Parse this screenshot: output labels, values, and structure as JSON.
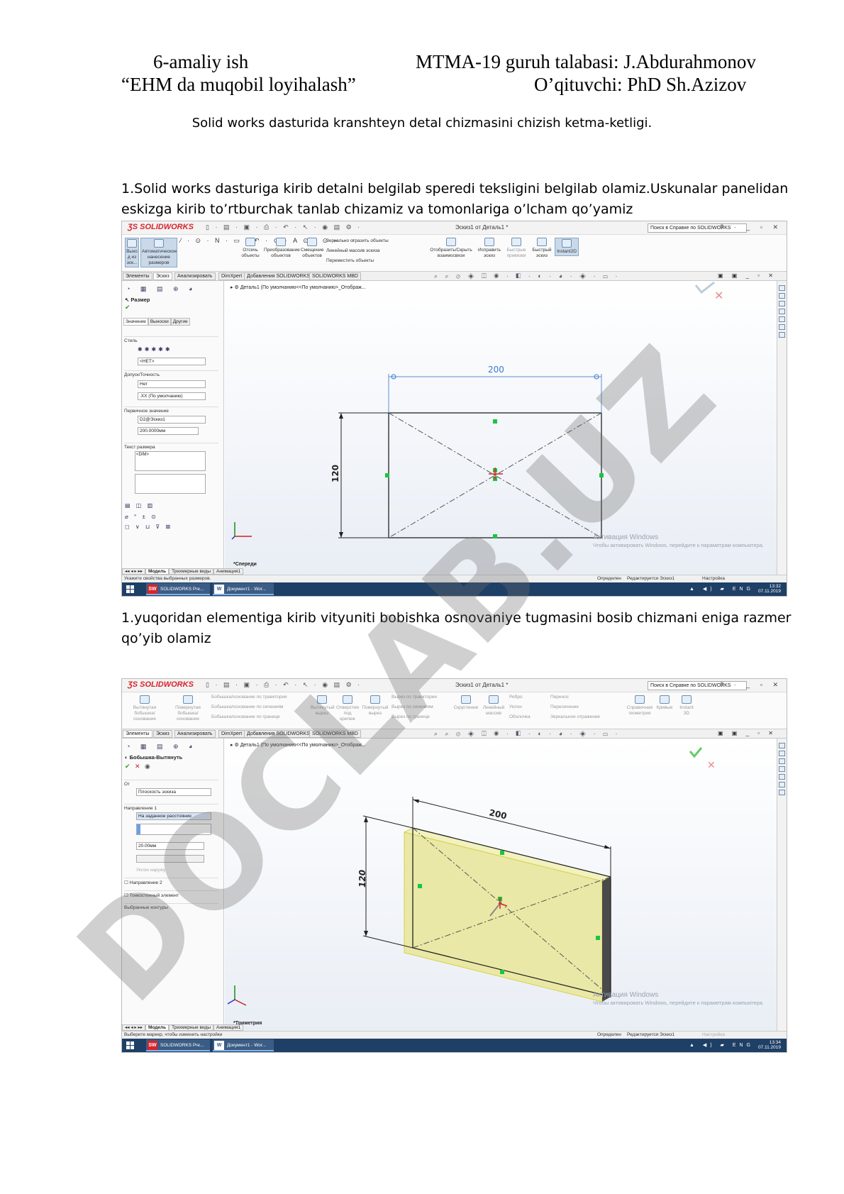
{
  "header": {
    "left_line1": "6-amaliy ish",
    "left_line2": "“EHM da muqobil loyihalash”",
    "right_line1": "MTMA-19 guruh talabasi:  J.Abdurahmonov",
    "right_line2": "O’qituvchi: PhD Sh.Azizov"
  },
  "subtitle": "Solid works dasturida kranshteyn detal chizmasini chizish ketma-ketligi.",
  "step1": {
    "line1": "1.Solid works dasturiga kirib detalni belgilab speredi teksligini belgilab olamiz.Uskunalar panelidan",
    "line2": "eskizga kirib to’rtburchak tanlab chizamiz va tomonlariga o’lcham qo’yamiz"
  },
  "step2": {
    "line1": "1.yuqoridan elementiga kirib vityuniti bobishka osnovaniye tugmasini bosib chizmani eniga razmer",
    "line2": "qo’yib olamiz"
  },
  "watermark": "DOCLAB.UZ",
  "screenshot1": {
    "app_logo": "SOLIDWORKS",
    "doc_title": "Эскиз1 от Деталь1 *",
    "help_search": "Поиск в Справке по SOLIDWORKS",
    "ribbon": {
      "exit_sketch": "Выхо д из эск...",
      "smart_dim": "Автоматическое нанесение размеров",
      "trim": "Отсечь объекты",
      "convert": "Преобразование объектов",
      "offset": "Смещение объектов",
      "mirror": "Зеркально отразить объекты",
      "linear_pattern": "Линейный массив эскиза",
      "move": "Переместить объекты",
      "show_hide": "Отобразить/Скрыть взаимосвязи",
      "repair": "Исправить эскиз",
      "quick_snaps": "Быстрые привязки",
      "rapid_sketch": "Быстрый эскиз",
      "instant2d": "Instant2D"
    },
    "tabs": [
      "Элементы",
      "Эскиз",
      "Анализировать",
      "DimXpert",
      "Добавления SOLIDWORKS",
      "SOLIDWORKS MBD"
    ],
    "panel": {
      "title": "Размер",
      "subtabs": [
        "Значение",
        "Выноски",
        "Другие"
      ],
      "style": "Стиль",
      "style_value": "<НЕТ>",
      "tolerance": "Допуск/Точность",
      "tol_value": "Нет",
      "precision_value": ".XX (По умолчанию)",
      "primary": "Первичное значение",
      "primary_name": "D2@Эскиз1",
      "primary_value": "200.0000мм",
      "dim_text": "Текст размера",
      "dim_text_value": "<DIM>"
    },
    "tree_item": "Деталь1  (По умолчанию<<По умолчанию>_Отображ...",
    "viewport": "*Спереди",
    "dim_width": "200",
    "dim_height": "120",
    "model_tabs": [
      "Модель",
      "Трехмерные виды",
      "Анимация1"
    ],
    "status_left": "Укажите свойства выбранных размеров.",
    "status_defined": "Определен",
    "status_editing": "Редактируется Эскиз1",
    "status_settings": "Настройка",
    "task_sw": "SOLIDWORKS Pre...",
    "task_word": "Документ1 - Wor...",
    "lang": "ENG",
    "time": "13:32",
    "date": "07.11.2019",
    "activation_title": "Активация Windows",
    "activation_text": "Чтобы активировать Windows, перейдите к параметрам компьютера."
  },
  "screenshot2": {
    "app_logo": "SOLIDWORKS",
    "doc_title": "Эскиз1 от Деталь1 *",
    "help_search": "Поиск в Справке по SOLIDWORKS",
    "ribbon": {
      "extrude_boss": "Вытянутая бобышка/основание",
      "revolve_boss": "Повернутая бобышка/основание",
      "swept_boss": "Бобышка/основание по траектории",
      "lofted_boss": "Бобышка/основание по сечениям",
      "boundary_boss": "Бобышка/основание по границе",
      "extruded_cut": "Вытянутый вырез",
      "hole": "Отверстие под крепеж",
      "revolved_cut": "Повернутый вырез",
      "swept_cut": "Вырез по траектории",
      "lofted_cut": "Вырез по сечениям",
      "boundary_cut": "Вырез по границе",
      "fillet": "Скругление",
      "linear_pattern": "Линейный массив",
      "rib": "Ребро",
      "draft": "Уклон",
      "shell": "Оболочка",
      "wrap": "Перенос",
      "intersect": "Пересечение",
      "mirror": "Зеркальное отражение",
      "ref_geometry": "Справочная геометрия",
      "curves": "Кривые",
      "instant3d": "Instant 3D"
    },
    "tabs": [
      "Элементы",
      "Эскиз",
      "Анализировать",
      "DimXpert",
      "Добавления SOLIDWORKS",
      "SOLIDWORKS MBD"
    ],
    "panel": {
      "title": "Бобышка-Вытянуть",
      "from": "От",
      "from_value": "Плоскость эскиза",
      "direction1": "Направление 1",
      "dir_value": "На заданное расстояние",
      "depth": "20.00мм",
      "draft": "Уклон наружу",
      "direction2": "Направление 2",
      "thin": "Тонкостенный элемент",
      "contours": "Выбранные контуры"
    },
    "tree_item": "Деталь1  (По умолчанию<<По умолчанию>_Отображ...",
    "viewport": "*Триметрия",
    "dim_width": "200",
    "dim_height": "120",
    "model_tabs": [
      "Модель",
      "Трехмерные виды",
      "Анимация1"
    ],
    "status_left": "Выберите маркер, чтобы изменить настройки",
    "status_defined": "Определен",
    "status_editing": "Редактируется Эскиз1",
    "status_settings": "Настройка",
    "task_sw": "SOLIDWORKS Pre...",
    "task_word": "Документ1 - Wor...",
    "lang": "ENG",
    "time": "13:34",
    "date": "07.11.2019",
    "activation_title": "Активация Windows",
    "activation_text": "Чтобы активировать Windows, перейдите к параметрам компьютера."
  }
}
